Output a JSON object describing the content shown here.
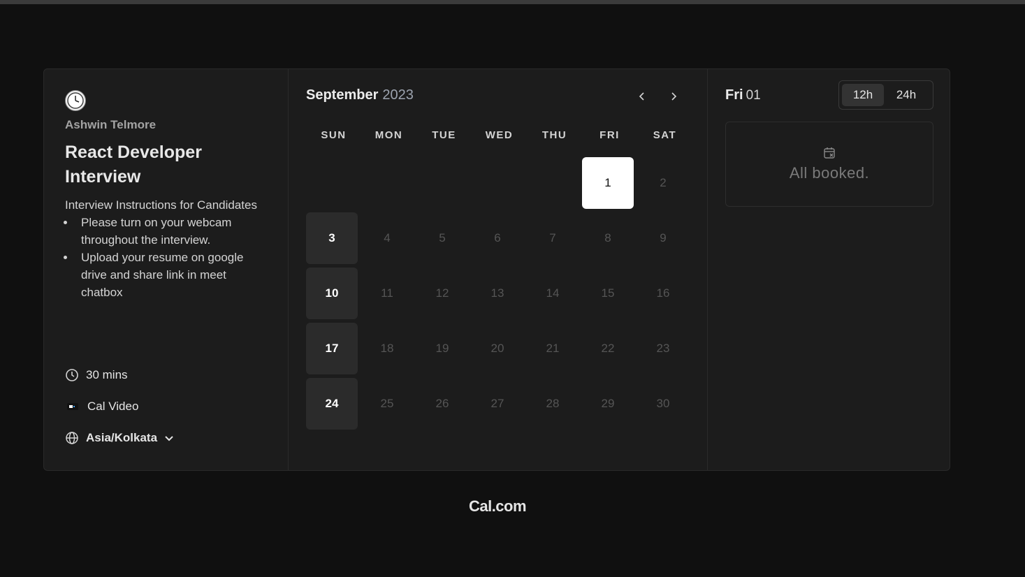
{
  "host": {
    "name": "Ashwin Telmore"
  },
  "event": {
    "title": "React Developer Interview",
    "intro": "Interview Instructions for Candidates",
    "bullets": [
      "Please turn on your webcam throughout the interview.",
      "Upload your resume on google drive and share link in meet chatbox"
    ],
    "duration": "30 mins",
    "location": "Cal Video",
    "timezone": "Asia/Kolkata"
  },
  "calendar": {
    "month": "September",
    "year": "2023",
    "weekdays": [
      "SUN",
      "MON",
      "TUE",
      "WED",
      "THU",
      "FRI",
      "SAT"
    ],
    "leading_blanks": 5,
    "days": [
      "1",
      "2",
      "3",
      "4",
      "5",
      "6",
      "7",
      "8",
      "9",
      "10",
      "11",
      "12",
      "13",
      "14",
      "15",
      "16",
      "17",
      "18",
      "19",
      "20",
      "21",
      "22",
      "23",
      "24",
      "25",
      "26",
      "27",
      "28",
      "29",
      "30"
    ],
    "available_days": [
      "3",
      "10",
      "17",
      "24"
    ],
    "selected_day": "1"
  },
  "selected": {
    "weekday": "Fri",
    "day": "01",
    "empty_message": "All booked."
  },
  "time_format": {
    "options": [
      "12h",
      "24h"
    ],
    "active": "12h"
  },
  "brand": "Cal.com",
  "colors": {
    "background": "#101010",
    "card": "#1c1c1c",
    "available_day": "#2b2b2b",
    "selected_day": "#ffffff"
  }
}
